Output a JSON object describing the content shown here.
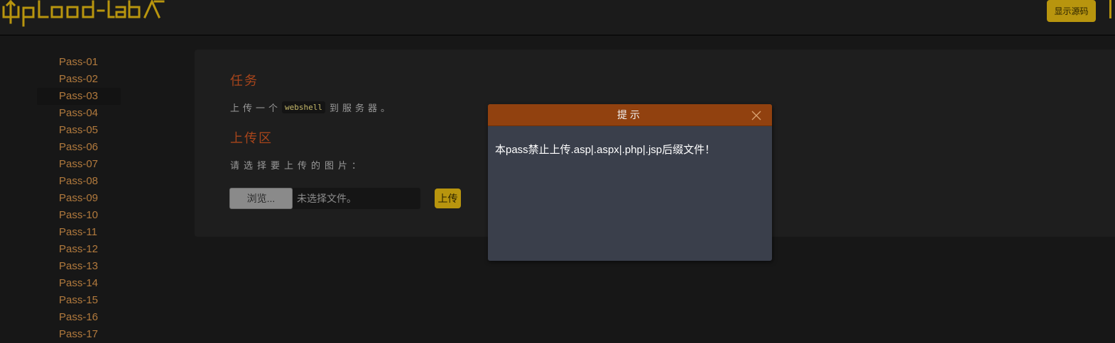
{
  "header": {
    "logo_name": "upload-labs-logo",
    "show_source_label": "显示源码"
  },
  "sidebar": {
    "active_index": 2,
    "items": [
      {
        "label": "Pass-01"
      },
      {
        "label": "Pass-02"
      },
      {
        "label": "Pass-03"
      },
      {
        "label": "Pass-04"
      },
      {
        "label": "Pass-05"
      },
      {
        "label": "Pass-06"
      },
      {
        "label": "Pass-07"
      },
      {
        "label": "Pass-08"
      },
      {
        "label": "Pass-09"
      },
      {
        "label": "Pass-10"
      },
      {
        "label": "Pass-11"
      },
      {
        "label": "Pass-12"
      },
      {
        "label": "Pass-13"
      },
      {
        "label": "Pass-14"
      },
      {
        "label": "Pass-15"
      },
      {
        "label": "Pass-16"
      },
      {
        "label": "Pass-17"
      }
    ]
  },
  "main": {
    "task_title": "任务",
    "task_prefix": "上传一个",
    "task_code": "webshell",
    "task_suffix": "到服务器。",
    "upload_title": "上传区",
    "upload_prompt": "请选择要上传的图片：",
    "browse_label": "浏览...",
    "file_status": "未选择文件。",
    "upload_label": "上传"
  },
  "dialog": {
    "title": "提示",
    "message": "本pass禁止上传.asp|.aspx|.php|.jsp后缀文件！",
    "close_icon": "close-icon"
  },
  "colors": {
    "accent_gold": "#b8950e",
    "link_orange": "#b27a3d",
    "title_rust": "#a8451b",
    "dialog_header": "#91410f",
    "dialog_body": "#3a3f4b"
  }
}
